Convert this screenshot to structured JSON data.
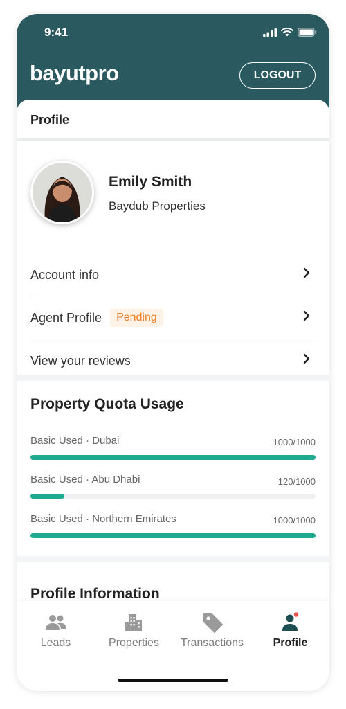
{
  "status_bar": {
    "time": "9:41"
  },
  "header": {
    "logo": "bayutpro",
    "logout_label": "LOGOUT"
  },
  "page": {
    "title": "Profile"
  },
  "user": {
    "name": "Emily Smith",
    "company": "Baydub Properties"
  },
  "menu": [
    {
      "label": "Account info"
    },
    {
      "label": "Agent Profile",
      "badge": "Pending"
    },
    {
      "label": "View your reviews"
    }
  ],
  "quota": {
    "title": "Property Quota Usage",
    "items": [
      {
        "label": "Basic Used · Dubai",
        "value": "1000/1000",
        "fraction": 1.0
      },
      {
        "label": "Basic Used · Abu Dhabi",
        "value": "120/1000",
        "fraction": 0.12
      },
      {
        "label": "Basic Used · Northern Emirates",
        "value": "1000/1000",
        "fraction": 1.0
      }
    ]
  },
  "profile_info": {
    "title": "Profile Information"
  },
  "tabs": [
    {
      "label": "Leads",
      "icon": "people-icon"
    },
    {
      "label": "Properties",
      "icon": "building-icon"
    },
    {
      "label": "Transactions",
      "icon": "tag-icon"
    },
    {
      "label": "Profile",
      "icon": "profile-icon",
      "active": true
    }
  ],
  "colors": {
    "brand": "#2a5a5f",
    "accent": "#1eaa8f",
    "pending": "#f07c1e",
    "notification": "#e8504f"
  }
}
